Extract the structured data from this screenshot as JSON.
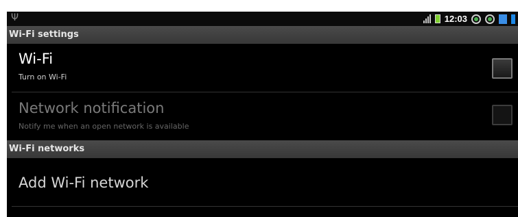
{
  "status_bar": {
    "usb_icon": "usb-icon",
    "time": "12:03"
  },
  "sections": {
    "wifi_settings": "Wi-Fi settings",
    "wifi_networks": "Wi-Fi networks"
  },
  "items": {
    "wifi": {
      "title": "Wi-Fi",
      "summary": "Turn on Wi-Fi",
      "checked": false
    },
    "network_notification": {
      "title": "Network notification",
      "summary": "Notify me when an open network is available",
      "checked": false,
      "enabled": false
    },
    "add_network": {
      "title": "Add Wi-Fi network"
    }
  }
}
